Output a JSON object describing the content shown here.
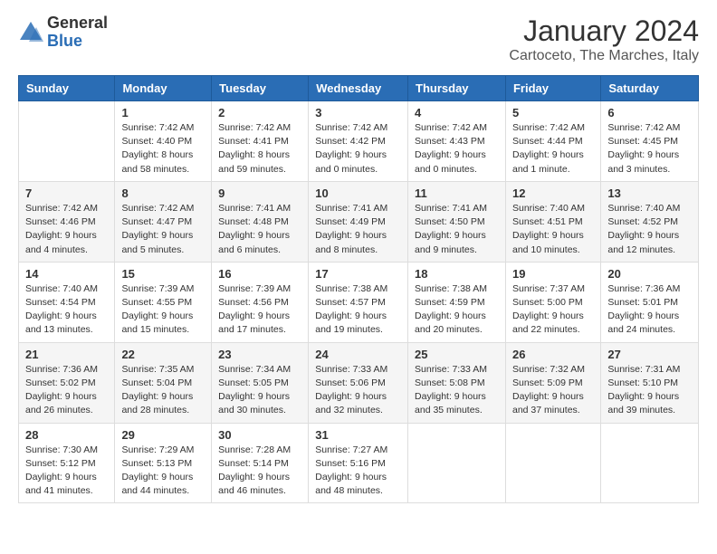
{
  "header": {
    "logo_general": "General",
    "logo_blue": "Blue",
    "month_title": "January 2024",
    "location": "Cartoceto, The Marches, Italy"
  },
  "weekdays": [
    "Sunday",
    "Monday",
    "Tuesday",
    "Wednesday",
    "Thursday",
    "Friday",
    "Saturday"
  ],
  "weeks": [
    [
      {
        "day": "",
        "info": ""
      },
      {
        "day": "1",
        "info": "Sunrise: 7:42 AM\nSunset: 4:40 PM\nDaylight: 8 hours\nand 58 minutes."
      },
      {
        "day": "2",
        "info": "Sunrise: 7:42 AM\nSunset: 4:41 PM\nDaylight: 8 hours\nand 59 minutes."
      },
      {
        "day": "3",
        "info": "Sunrise: 7:42 AM\nSunset: 4:42 PM\nDaylight: 9 hours\nand 0 minutes."
      },
      {
        "day": "4",
        "info": "Sunrise: 7:42 AM\nSunset: 4:43 PM\nDaylight: 9 hours\nand 0 minutes."
      },
      {
        "day": "5",
        "info": "Sunrise: 7:42 AM\nSunset: 4:44 PM\nDaylight: 9 hours\nand 1 minute."
      },
      {
        "day": "6",
        "info": "Sunrise: 7:42 AM\nSunset: 4:45 PM\nDaylight: 9 hours\nand 3 minutes."
      }
    ],
    [
      {
        "day": "7",
        "info": "Sunrise: 7:42 AM\nSunset: 4:46 PM\nDaylight: 9 hours\nand 4 minutes."
      },
      {
        "day": "8",
        "info": "Sunrise: 7:42 AM\nSunset: 4:47 PM\nDaylight: 9 hours\nand 5 minutes."
      },
      {
        "day": "9",
        "info": "Sunrise: 7:41 AM\nSunset: 4:48 PM\nDaylight: 9 hours\nand 6 minutes."
      },
      {
        "day": "10",
        "info": "Sunrise: 7:41 AM\nSunset: 4:49 PM\nDaylight: 9 hours\nand 8 minutes."
      },
      {
        "day": "11",
        "info": "Sunrise: 7:41 AM\nSunset: 4:50 PM\nDaylight: 9 hours\nand 9 minutes."
      },
      {
        "day": "12",
        "info": "Sunrise: 7:40 AM\nSunset: 4:51 PM\nDaylight: 9 hours\nand 10 minutes."
      },
      {
        "day": "13",
        "info": "Sunrise: 7:40 AM\nSunset: 4:52 PM\nDaylight: 9 hours\nand 12 minutes."
      }
    ],
    [
      {
        "day": "14",
        "info": "Sunrise: 7:40 AM\nSunset: 4:54 PM\nDaylight: 9 hours\nand 13 minutes."
      },
      {
        "day": "15",
        "info": "Sunrise: 7:39 AM\nSunset: 4:55 PM\nDaylight: 9 hours\nand 15 minutes."
      },
      {
        "day": "16",
        "info": "Sunrise: 7:39 AM\nSunset: 4:56 PM\nDaylight: 9 hours\nand 17 minutes."
      },
      {
        "day": "17",
        "info": "Sunrise: 7:38 AM\nSunset: 4:57 PM\nDaylight: 9 hours\nand 19 minutes."
      },
      {
        "day": "18",
        "info": "Sunrise: 7:38 AM\nSunset: 4:59 PM\nDaylight: 9 hours\nand 20 minutes."
      },
      {
        "day": "19",
        "info": "Sunrise: 7:37 AM\nSunset: 5:00 PM\nDaylight: 9 hours\nand 22 minutes."
      },
      {
        "day": "20",
        "info": "Sunrise: 7:36 AM\nSunset: 5:01 PM\nDaylight: 9 hours\nand 24 minutes."
      }
    ],
    [
      {
        "day": "21",
        "info": "Sunrise: 7:36 AM\nSunset: 5:02 PM\nDaylight: 9 hours\nand 26 minutes."
      },
      {
        "day": "22",
        "info": "Sunrise: 7:35 AM\nSunset: 5:04 PM\nDaylight: 9 hours\nand 28 minutes."
      },
      {
        "day": "23",
        "info": "Sunrise: 7:34 AM\nSunset: 5:05 PM\nDaylight: 9 hours\nand 30 minutes."
      },
      {
        "day": "24",
        "info": "Sunrise: 7:33 AM\nSunset: 5:06 PM\nDaylight: 9 hours\nand 32 minutes."
      },
      {
        "day": "25",
        "info": "Sunrise: 7:33 AM\nSunset: 5:08 PM\nDaylight: 9 hours\nand 35 minutes."
      },
      {
        "day": "26",
        "info": "Sunrise: 7:32 AM\nSunset: 5:09 PM\nDaylight: 9 hours\nand 37 minutes."
      },
      {
        "day": "27",
        "info": "Sunrise: 7:31 AM\nSunset: 5:10 PM\nDaylight: 9 hours\nand 39 minutes."
      }
    ],
    [
      {
        "day": "28",
        "info": "Sunrise: 7:30 AM\nSunset: 5:12 PM\nDaylight: 9 hours\nand 41 minutes."
      },
      {
        "day": "29",
        "info": "Sunrise: 7:29 AM\nSunset: 5:13 PM\nDaylight: 9 hours\nand 44 minutes."
      },
      {
        "day": "30",
        "info": "Sunrise: 7:28 AM\nSunset: 5:14 PM\nDaylight: 9 hours\nand 46 minutes."
      },
      {
        "day": "31",
        "info": "Sunrise: 7:27 AM\nSunset: 5:16 PM\nDaylight: 9 hours\nand 48 minutes."
      },
      {
        "day": "",
        "info": ""
      },
      {
        "day": "",
        "info": ""
      },
      {
        "day": "",
        "info": ""
      }
    ]
  ]
}
